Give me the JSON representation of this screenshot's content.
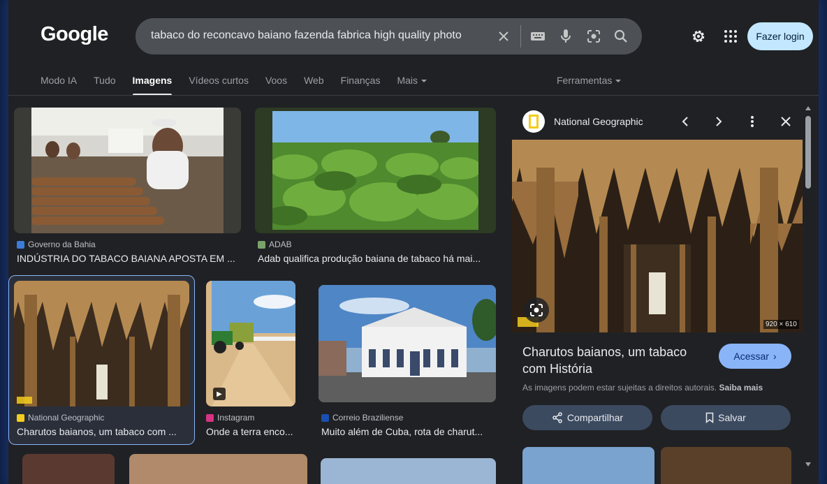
{
  "header": {
    "logo": "Google",
    "search_value": "tabaco do reconcavo baiano fazenda fabrica high quality photo",
    "login_label": "Fazer login"
  },
  "tabs": [
    {
      "label": "Modo IA"
    },
    {
      "label": "Tudo"
    },
    {
      "label": "Imagens",
      "active": true
    },
    {
      "label": "Vídeos curtos"
    },
    {
      "label": "Voos"
    },
    {
      "label": "Web"
    },
    {
      "label": "Finanças"
    },
    {
      "label": "Mais"
    }
  ],
  "tools_label": "Ferramentas",
  "results": [
    {
      "source": "Governo da Bahia",
      "title": "INDÚSTRIA DO TABACO BAIANA APOSTA EM ..."
    },
    {
      "source": "ADAB",
      "title": "Adab qualifica produção baiana de tabaco há mai..."
    },
    {
      "source": "National Geographic",
      "title": "Charutos baianos, um tabaco com ..."
    },
    {
      "source": "Instagram",
      "title": "Onde a terra enco..."
    },
    {
      "source": "Correio Braziliense",
      "title": "Muito além de Cuba, rota de charut..."
    }
  ],
  "panel": {
    "source": "National Geographic",
    "dimensions": "920 × 610",
    "title": "Charutos baianos, um tabaco com História",
    "visit_label": "Acessar",
    "rights_text": "As imagens podem estar sujeitas a direitos autorais.",
    "rights_link": "Saiba mais",
    "share_label": "Compartilhar",
    "save_label": "Salvar"
  }
}
